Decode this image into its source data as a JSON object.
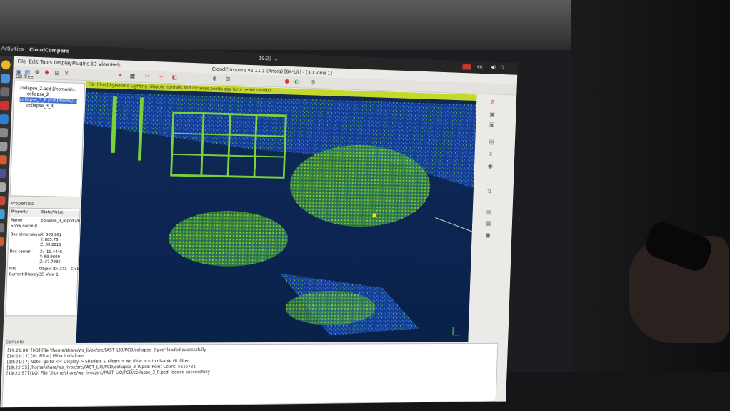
{
  "desktop": {
    "activities": "Activities",
    "app_menu": "CloudCompare",
    "clock": "ه. 19:23",
    "lang": "en"
  },
  "window": {
    "title": "CloudCompare v2.11.1 (Anoia) [64-bit] - [3D View 1]",
    "menus": [
      "File",
      "Edit",
      "Tools",
      "Display",
      "Plugins",
      "3D Views",
      "Help"
    ]
  },
  "db_tree": {
    "title": "DB Tree",
    "items": [
      "collapse_2.pcd [/home/sh...",
      "collapse_2",
      "collapse_3_R.pcd [/home/...",
      "collapse_3_R"
    ]
  },
  "properties": {
    "title": "Properties",
    "headers": [
      "Property",
      "State/Value"
    ],
    "rows": [
      [
        "Name",
        "collapse_3_R.pcd (/h"
      ],
      [
        "Show name (i...",
        ""
      ],
      [
        "Box dimensions",
        "X: 303.961"
      ],
      [
        "",
        "Y: 885.76"
      ],
      [
        "",
        "Z: 89.2813"
      ],
      [
        "Box center",
        "X: -10.4446"
      ],
      [
        "",
        "Y: 59.9609"
      ],
      [
        "",
        "Z: 37.7835"
      ],
      [
        "Info",
        "Object ID: 273 - Child"
      ],
      [
        "Current Display",
        "3D View 1"
      ]
    ]
  },
  "view3d": {
    "filter_message": "[GL filter] EyeDome-Lighting (disable normals and increase points size for a better result!)"
  },
  "console": {
    "title": "Console",
    "lines": [
      "[19:21:04] [I/O] File '/home/share/ws_livox/src/FAST_LIO/PCD/collapse_2.pcd' loaded successfully",
      "[19:21:17] [GL Filter] Filter initialized",
      "[19:21:17] Note: go to << Display > Shaders & Filters > No filter >> to disable GL filter",
      "[19:22:35] /home/share/ws_livox/src/FAST_LIO/PCD/collapse_3_R.pcd: Point Count: 5215721",
      "[19:22:57] [I/O] File '/home/share/ws_livox/src/FAST_LIO/PCD/collapse_3_R.pcd' loaded successfully"
    ]
  }
}
